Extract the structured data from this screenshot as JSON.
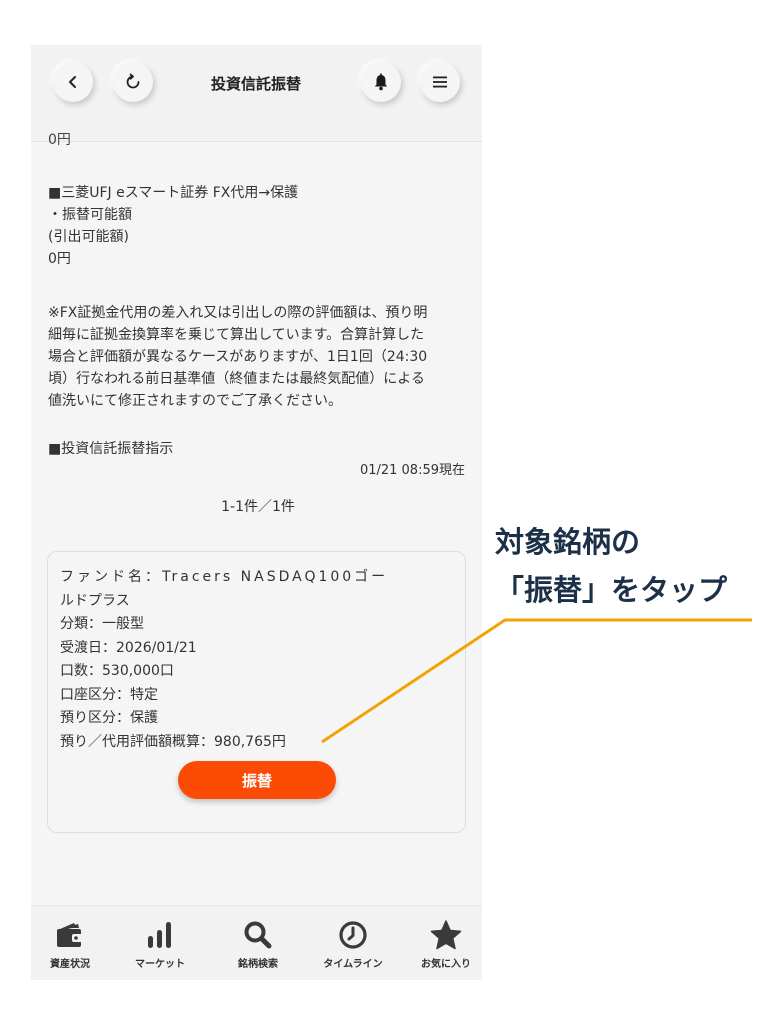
{
  "header": {
    "title": "投資信託振替",
    "back_icon": "chevron-left-icon",
    "reload_icon": "refresh-icon",
    "bell_icon": "bell-icon",
    "menu_icon": "hamburger-menu-icon"
  },
  "content": {
    "cut_text": "0円",
    "section1": {
      "title": "■三菱UFJ eスマート証券 FX代用→保護",
      "line1": "・振替可能額",
      "line2": "(引出可能額)",
      "value": "0円"
    },
    "note": {
      "line1": "※FX証拠金代用の差入れ又は引出しの際の評価額は、預り明",
      "line2": "細毎に証拠金換算率を乗じて算出しています。合算計算した",
      "line3": "場合と評価額が異なるケースがありますが、1日1回（24:30",
      "line4": "頃）行なわれる前日基準値（終値または最終気配値）による",
      "line5": "値洗いにて修正されますのでご了承ください。"
    },
    "section2_title": "■投資信託振替指示",
    "timestamp": "01/21 08:59現在",
    "count": "1-1件／1件"
  },
  "card": {
    "fund_line1": "ファンド名：Tracers NASDAQ100ゴー",
    "fund_line2": "ルドプラス",
    "category": "分類：一般型",
    "delivery_date": "受渡日：2026/01/21",
    "units": "口数：530,000口",
    "account_type": "口座区分：特定",
    "custody_type": "預り区分：保護",
    "valuation": "預り／代用評価額概算：980,765円",
    "transfer_label": "振替"
  },
  "bottom_nav": [
    {
      "label": "資産状況",
      "icon": "wallet-icon"
    },
    {
      "label": "マーケット",
      "icon": "bar-chart-icon"
    },
    {
      "label": "銘柄検索",
      "icon": "search-icon"
    },
    {
      "label": "タイムライン",
      "icon": "clock-icon"
    },
    {
      "label": "お気に入り",
      "icon": "star-icon"
    }
  ],
  "annotation": {
    "line1": "対象銘柄の",
    "line2": "「振替」をタップ",
    "color": "#f0a30a"
  },
  "colors": {
    "accent": "#fb4b05",
    "annotation_text": "#1c3048"
  }
}
